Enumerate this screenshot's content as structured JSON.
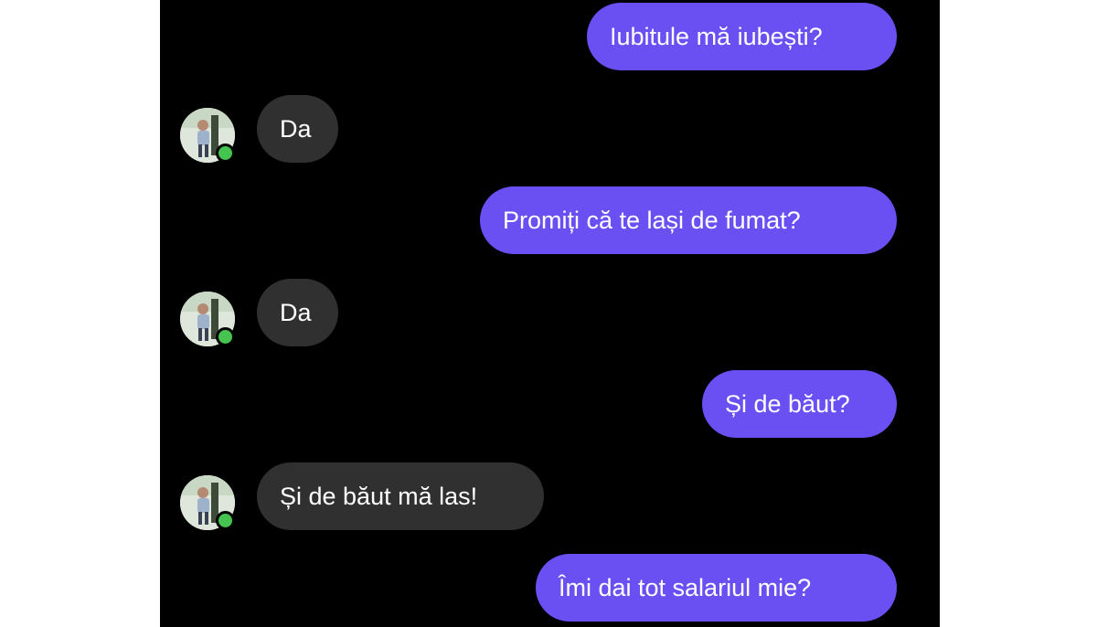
{
  "conversation": {
    "messages": [
      {
        "sender": "me",
        "text": "Iubitule mă iubești?"
      },
      {
        "sender": "contact",
        "text": "Da"
      },
      {
        "sender": "me",
        "text": "Promiți că te lași de fumat?"
      },
      {
        "sender": "contact",
        "text": "Da"
      },
      {
        "sender": "me",
        "text": "Și de băut?"
      },
      {
        "sender": "contact",
        "text": "Și de băut mă las!"
      },
      {
        "sender": "me",
        "text": "Îmi dai tot salariul mie?"
      }
    ]
  },
  "colors": {
    "background": "#000000",
    "outgoing_bubble": "#6a4ff2",
    "incoming_bubble": "#303030",
    "online_status": "#45c44f"
  },
  "icons": {
    "avatar": "contact-avatar-photo",
    "presence": "online-status-dot"
  }
}
